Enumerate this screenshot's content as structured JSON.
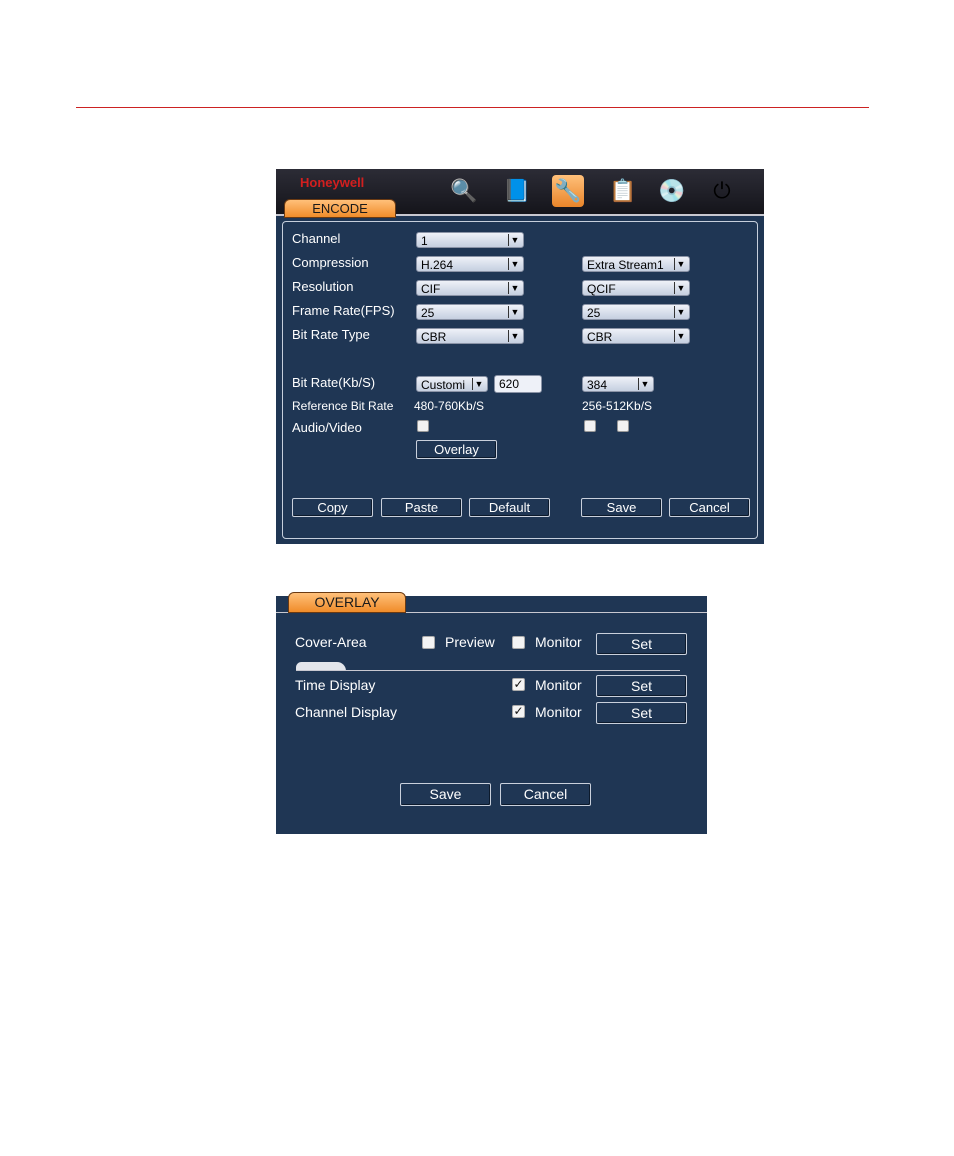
{
  "encode": {
    "brand": "Honeywell",
    "tab_label": "ENCODE",
    "icons": [
      {
        "name": "search-icon",
        "glyph": "🔍"
      },
      {
        "name": "info-icon",
        "glyph": "📘"
      },
      {
        "name": "settings-tools-icon",
        "glyph": "🔧"
      },
      {
        "name": "advanced-icon",
        "glyph": "📋"
      },
      {
        "name": "backup-icon",
        "glyph": "💿"
      },
      {
        "name": "shutdown-icon",
        "glyph": "⏻"
      }
    ],
    "labels": {
      "channel": "Channel",
      "compression": "Compression",
      "resolution": "Resolution",
      "frame_rate": "Frame Rate(FPS)",
      "bit_rate_type": "Bit Rate Type",
      "bit_rate": "Bit Rate(Kb/S)",
      "reference_bit_rate": "Reference Bit Rate",
      "audio_video": "Audio/Video"
    },
    "main": {
      "channel": "1",
      "compression": "H.264",
      "resolution": "CIF",
      "frame_rate": "25",
      "bit_rate_type": "CBR",
      "bit_rate_mode": "Customi",
      "bit_rate_value": "620",
      "reference_bit_rate": "480-760Kb/S"
    },
    "extra": {
      "stream": "Extra Stream1",
      "resolution": "QCIF",
      "frame_rate": "25",
      "bit_rate_type": "CBR",
      "bit_rate": "384",
      "reference_bit_rate": "256-512Kb/S"
    },
    "buttons": {
      "overlay": "Overlay",
      "copy": "Copy",
      "paste": "Paste",
      "default": "Default",
      "save": "Save",
      "cancel": "Cancel"
    }
  },
  "overlay": {
    "tab_label": "OVERLAY",
    "cover_area": "Cover-Area",
    "preview": "Preview",
    "monitor": "Monitor",
    "time_display": "Time Display",
    "channel_display": "Channel Display",
    "set": "Set",
    "save": "Save",
    "cancel": "Cancel"
  }
}
